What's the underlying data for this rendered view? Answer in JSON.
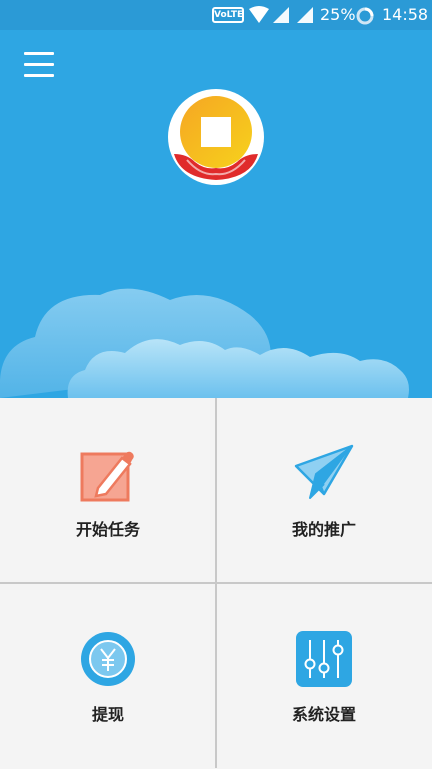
{
  "status_bar": {
    "volte": "VoLTE",
    "battery": "25%",
    "time": "14:58"
  },
  "header": {
    "menu_icon": "hamburger-menu-icon",
    "logo_icon": "coin-in-hands-logo"
  },
  "menu": {
    "items": [
      {
        "label": "开始任务",
        "icon": "edit-pencil-icon",
        "color": "#f2896e"
      },
      {
        "label": "我的推广",
        "icon": "paper-plane-icon",
        "color": "#2ea6e3"
      },
      {
        "label": "提现",
        "icon": "yuan-coin-icon",
        "color": "#2ea6e3"
      },
      {
        "label": "系统设置",
        "icon": "sliders-settings-icon",
        "color": "#2ea6e3"
      }
    ]
  }
}
